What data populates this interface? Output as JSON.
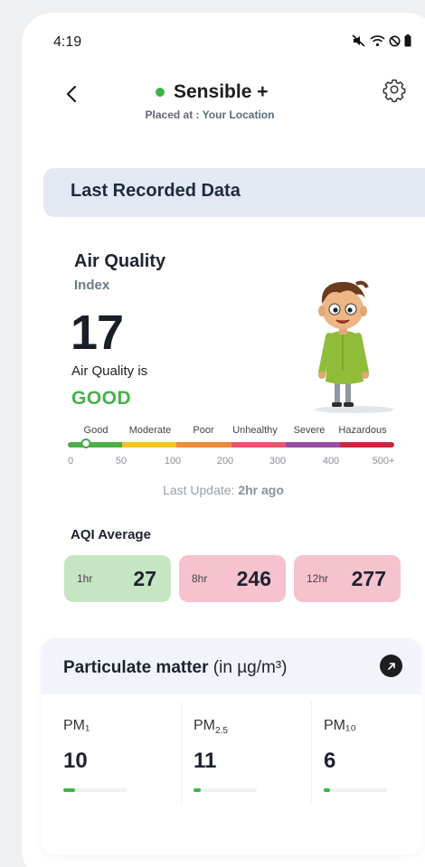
{
  "status_bar": {
    "time": "4:19"
  },
  "header": {
    "device_name": "Sensible +",
    "placed_prefix": "Placed at : ",
    "placed_location": "Your Location"
  },
  "banner": {
    "title": "Last Recorded Data"
  },
  "aqi": {
    "title": "Air Quality",
    "subtitle": "Index",
    "value": "17",
    "is_label": "Air Quality is",
    "status": "GOOD",
    "status_color": "#47b24e",
    "scale_labels": [
      "Good",
      "Moderate",
      "Poor",
      "Unhealthy",
      "Severe",
      "Hazardous"
    ],
    "scale_colors": [
      "#4cae49",
      "#f2c231",
      "#ed8c3a",
      "#e8546e",
      "#9a4da4",
      "#cc2740"
    ],
    "scale_ticks": [
      "0",
      "50",
      "100",
      "200",
      "300",
      "400",
      "500+"
    ],
    "marker_value": 17,
    "last_update_prefix": "Last Update: ",
    "last_update_value": "2hr ago"
  },
  "aqi_average": {
    "title": "AQI Average",
    "items": [
      {
        "period": "1hr",
        "value": "27",
        "color": "#c6e6c3"
      },
      {
        "period": "8hr",
        "value": "246",
        "color": "#f6c2cd"
      },
      {
        "period": "12hr",
        "value": "277",
        "color": "#f6c2cd"
      }
    ]
  },
  "particulate": {
    "title_bold": "Particulate matter",
    "title_unit": " (in µg/m³)",
    "items": [
      {
        "label": "PM₁",
        "value": "10",
        "fill_fraction": 0.18
      },
      {
        "label_main": "PM",
        "label_sub": "2.5",
        "value": "11",
        "fill_fraction": 0.12
      },
      {
        "label": "PM₁₀",
        "value": "6",
        "fill_fraction": 0.1
      }
    ]
  }
}
